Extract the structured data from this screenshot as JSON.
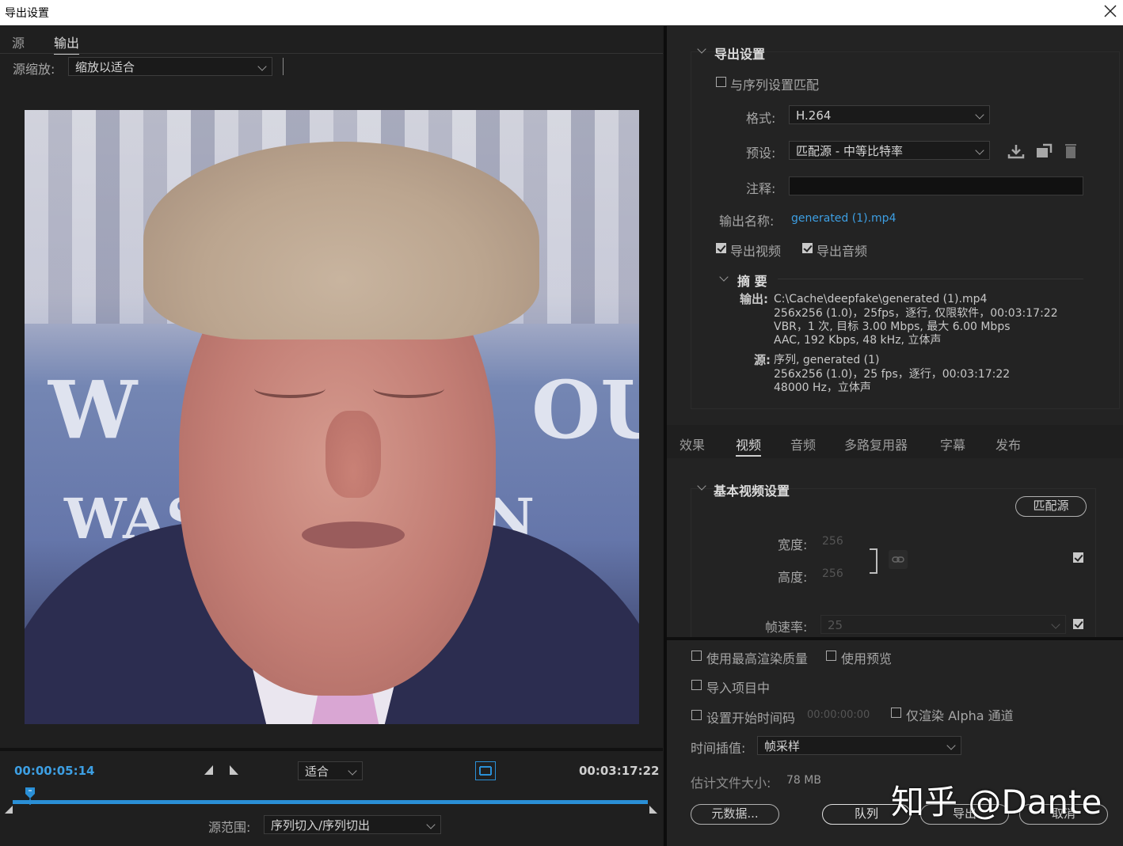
{
  "window": {
    "title": "导出设置"
  },
  "left": {
    "tabs": [
      "源",
      "输出"
    ],
    "scale_label": "源缩放:",
    "scale_value": "缩放以适合",
    "timecode_current": "00:00:05:14",
    "fit_value": "适合",
    "timecode_total": "00:03:17:22",
    "range_label": "源范围:",
    "range_value": "序列切入/序列切出",
    "photo_text": {
      "line1": "W",
      "line1b": "OU",
      "line2": "WAS",
      "line2b": "N"
    }
  },
  "export": {
    "section_title": "导出设置",
    "match_seq": "与序列设置匹配",
    "format_label": "格式:",
    "format_value": "H.264",
    "preset_label": "预设:",
    "preset_value": "匹配源 - 中等比特率",
    "comment_label": "注释:",
    "comment_value": "",
    "output_name_label": "输出名称:",
    "output_name_value": "generated (1).mp4",
    "export_video": "导出视频",
    "export_audio": "导出音频",
    "summary_title": "摘 要",
    "output_key": "输出:",
    "output_lines": [
      "C:\\Cache\\deepfake\\generated (1).mp4",
      "256x256 (1.0)，25fps，逐行, 仅限软件，00:03:17:22",
      "VBR，1 次, 目标 3.00 Mbps, 最大 6.00 Mbps",
      "AAC, 192 Kbps, 48  kHz, 立体声"
    ],
    "source_key": "源:",
    "source_lines": [
      "序列, generated (1)",
      "256x256 (1.0)，25 fps，逐行，00:03:17:22",
      "48000 Hz，立体声"
    ]
  },
  "tabs2": [
    "效果",
    "视频",
    "音频",
    "多路复用器",
    "字幕",
    "发布"
  ],
  "video": {
    "section_title": "基本视频设置",
    "match_source_btn": "匹配源",
    "width_label": "宽度:",
    "width_value": "256",
    "height_label": "高度:",
    "height_value": "256",
    "fps_label": "帧速率:",
    "fps_value": "25"
  },
  "bottom": {
    "max_quality": "使用最高渲染质量",
    "use_preview": "使用预览",
    "import_project": "导入项目中",
    "set_start_tc": "设置开始时间码",
    "start_tc_value": "00:00:00:00",
    "alpha_only": "仅渲染 Alpha 通道",
    "interp_label": "时间插值:",
    "interp_value": "帧采样",
    "filesize_label": "估计文件大小:",
    "filesize_value": "78 MB",
    "metadata_btn": "元数据...",
    "queue_btn": "队列",
    "export_btn": "导出",
    "cancel_btn": "取消"
  },
  "watermark": "知乎 @Dante",
  "colors": {
    "accent": "#3d9fe3",
    "timeline": "#2a8fd6"
  }
}
